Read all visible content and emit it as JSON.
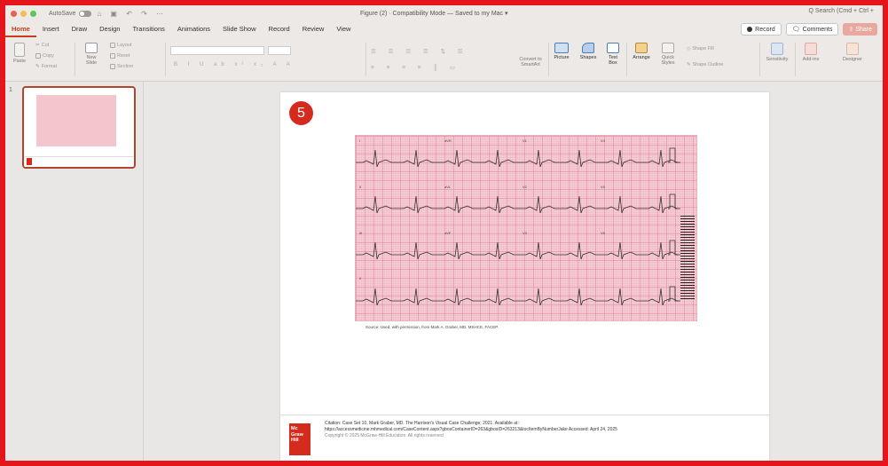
{
  "titlebar": {
    "autosave_label": "AutoSave",
    "doc_title": "Figure (2)  ·  Compatibility Mode — Saved to my Mac ▾",
    "search_placeholder": "Q  Search (Cmd + Ctrl +"
  },
  "tabs": [
    "Home",
    "Insert",
    "Draw",
    "Design",
    "Transitions",
    "Animations",
    "Slide Show",
    "Record",
    "Review",
    "View"
  ],
  "tab_actions": {
    "record_label": "Record",
    "comments_label": "Comments",
    "share_label": "Share"
  },
  "ribbon": {
    "paste_label": "Paste",
    "cut_label": "Cut",
    "copy_label": "Copy",
    "format_label": "Format",
    "new_slide_label": "New Slide",
    "layout_label": "Layout",
    "reset_label": "Reset",
    "section_label": "Section",
    "convert_smartart_label": "Convert to SmartArt",
    "picture_label": "Picture",
    "shapes_label": "Shapes",
    "text_box_label": "Text Box",
    "arrange_label": "Arrange",
    "quick_styles_label": "Quick Styles",
    "shape_fill_label": "Shape Fill",
    "shape_outline_label": "Shape Outline",
    "sensitivity_label": "Sensitivity",
    "addins_label": "Add-ins",
    "designer_label": "Designer"
  },
  "thumbnails": {
    "slide_number": "1"
  },
  "slide": {
    "badge_number": "5",
    "ecg_leads": [
      "I",
      "aVR",
      "V1",
      "V4",
      "II",
      "aVL",
      "V2",
      "V5",
      "III",
      "aVF",
      "V3",
      "V6",
      "II"
    ],
    "source_text": "Source: Used, with permission, from Mark A. Graber, MD, MSHCE, FACEP.",
    "logo_text": "Mc\nGraw\nHill",
    "citation_line1": "Citation: Case Set 10, Mark Graber, MD. The Harrison's Visual Case Challenge; 2021. Available at:",
    "citation_line2": "https://accessmedicine.mhmedical.com/CaseContent.aspx?gbosContainerID=263&gbosID=263213&tocItemByNumberJake Accessed: April 24, 2025",
    "copyright": "Copyright © 2025 McGraw-Hill Education. All rights reserved"
  }
}
